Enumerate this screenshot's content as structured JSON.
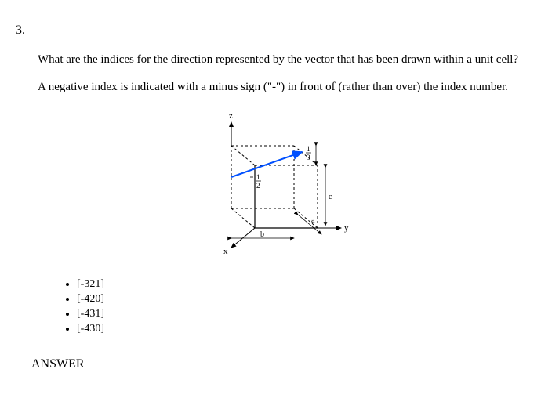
{
  "question": {
    "number": "3.",
    "prompt_line1": "What are the indices for the direction represented by the vector that has been drawn within a unit cell?",
    "prompt_line2": "A negative index is indicated with a minus sign (\"-\") in front of (rather than over) the index number."
  },
  "figure": {
    "axes": {
      "x": "x",
      "y": "y",
      "z": "z"
    },
    "edge_labels": {
      "a": "a",
      "b": "b",
      "c": "c"
    },
    "fractions": {
      "half": "1/2",
      "third": "1/3"
    }
  },
  "options": [
    "[-321]",
    "[-420]",
    "[-431]",
    "[-430]"
  ],
  "answer": {
    "label": "ANSWER",
    "value": ""
  },
  "chart_data": {
    "type": "diagram",
    "description": "Unit cell (right rectangular prism) with axes x (toward viewer-left), y (to right), z (up). Edge lengths labeled a (along x), b (along y), c (along z). A direction vector is drawn from a point on the back-left vertical edge at height 1/2 up, ending on the top-right edge at 1/3 below the top (so z start = c/2, z end ≈ 2c/3 or labeled 1/3 from top). Arrowhead at the termination near the top-front-right region.",
    "vector_start_fraction": {
      "x": 0,
      "y": 0,
      "z": 0.5
    },
    "vector_end_region": "toward +y top edge, 1/3 down from top",
    "labeled_fractions": [
      "1/2",
      "1/3"
    ]
  }
}
